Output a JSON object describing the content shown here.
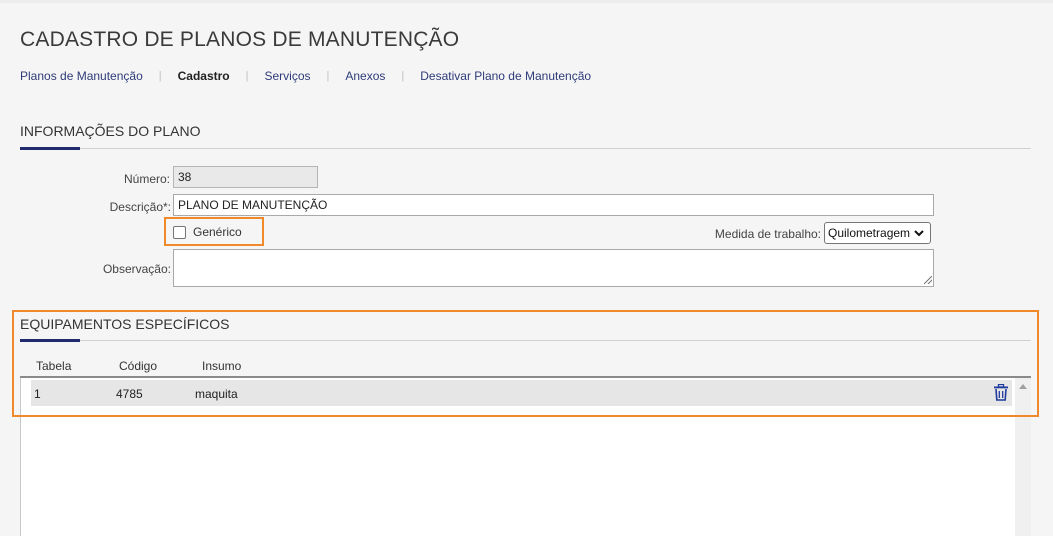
{
  "page_title": "CADASTRO DE PLANOS DE MANUTENÇÃO",
  "nav": [
    {
      "label": "Planos de Manutenção",
      "active": false
    },
    {
      "label": "Cadastro",
      "active": true
    },
    {
      "label": "Serviços",
      "active": false
    },
    {
      "label": "Anexos",
      "active": false
    },
    {
      "label": "Desativar Plano de Manutenção",
      "active": false
    }
  ],
  "nav_separator": "|",
  "plan_section": {
    "title": "INFORMAÇÕES DO PLANO",
    "numero_label": "Número:",
    "numero_value": "38",
    "descricao_label": "Descrição*:",
    "descricao_value": "PLANO DE MANUTENÇÃO",
    "generico_label": "Genérico",
    "generico_checked": false,
    "medida_label": "Medida de trabalho:",
    "medida_value": "Quilometragem",
    "observacao_label": "Observação:",
    "observacao_value": ""
  },
  "equip_section": {
    "title": "EQUIPAMENTOS ESPECÍFICOS",
    "columns": [
      "Tabela",
      "Código",
      "Insumo"
    ],
    "rows": [
      {
        "tabela": "1",
        "codigo": "4785",
        "insumo": "maquita"
      }
    ]
  },
  "colors": {
    "accent": "#1f2b6e",
    "highlight": "#f0892a",
    "link": "#2e3b78"
  },
  "icons": [
    "trash-icon",
    "chevron-down-icon",
    "scroll-up-arrow-icon"
  ]
}
